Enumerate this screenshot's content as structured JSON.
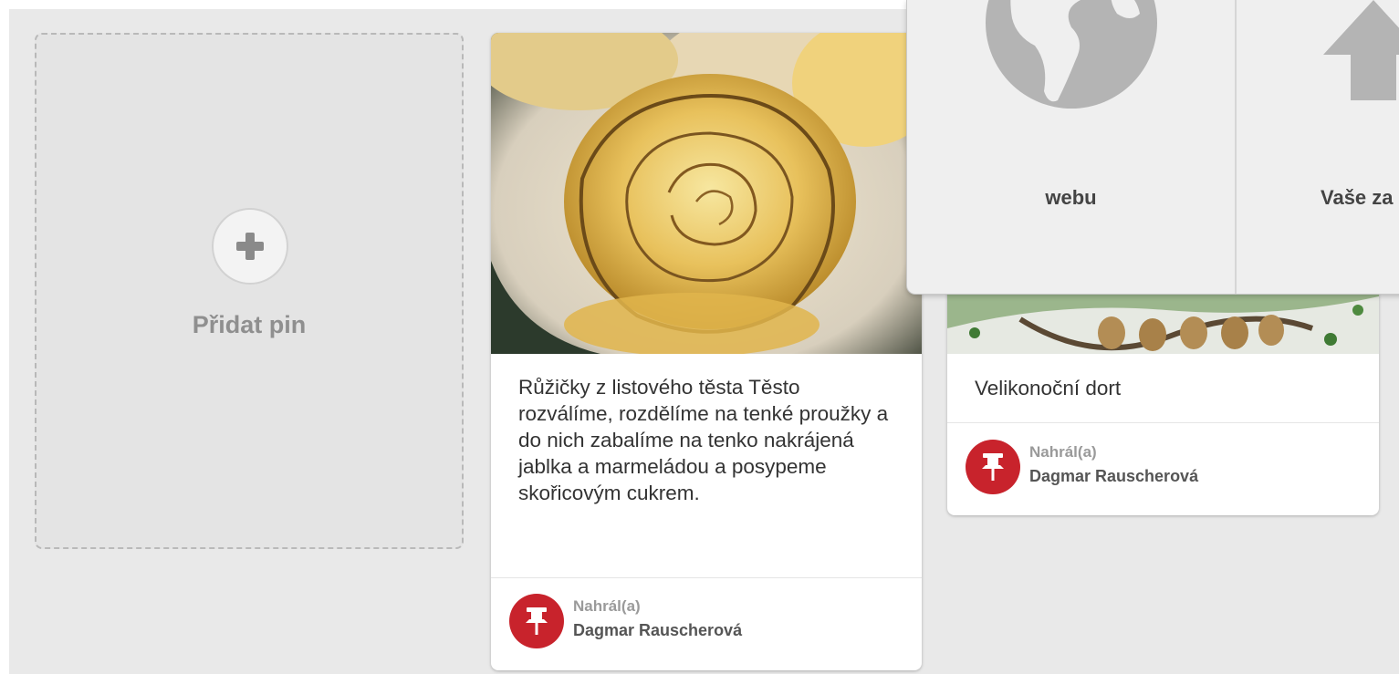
{
  "add_pin": {
    "label": "Přidat pin",
    "icon": "plus-icon"
  },
  "pins": [
    {
      "description": "Růžičky z listového těsta Těsto rozválíme, rozdělíme na tenké proužky a do nich zabalíme na tenko nakrájená jablka a marmeládou a posypeme skořicovým cukrem.",
      "uploaded_label": "Nahrál(a)",
      "author": "Dagmar Rauscherová",
      "image": "apple-rose-pastry-photo"
    },
    {
      "description": "Velikonoční dort",
      "uploaded_label": "Nahrál(a)",
      "author": "Dagmar Rauscherová",
      "image": "easter-cake-photo"
    }
  ],
  "popup": {
    "options": [
      {
        "label": "webu",
        "icon": "globe-icon"
      },
      {
        "label": "Vaše za",
        "icon": "upload-arrow-icon"
      }
    ]
  },
  "colors": {
    "board_background": "#e9e9e9",
    "pin_badge": "#c8232c",
    "popup_background": "#efefef"
  }
}
